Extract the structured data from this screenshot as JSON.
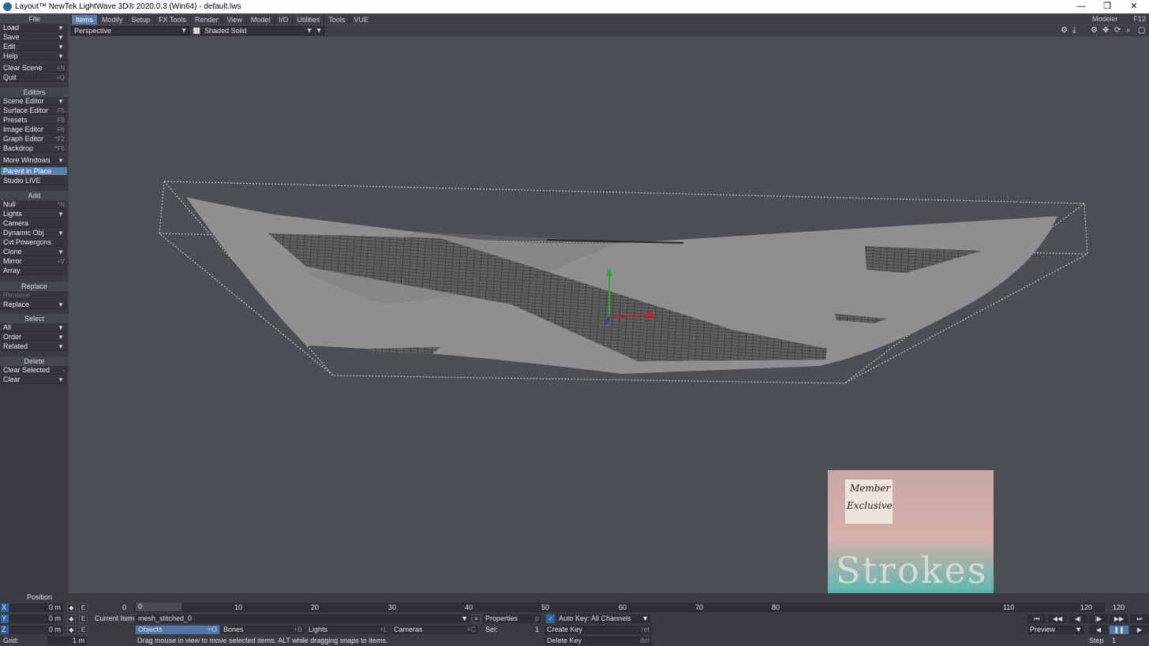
{
  "window": {
    "title": "Layout™ NewTek LightWave 3D® 2020.0.3 (Win64) - default.lws",
    "min": "—",
    "restore": "❐",
    "close": "✕"
  },
  "menubar": {
    "tabs": [
      "Items",
      "Modify",
      "Setup",
      "FX Tools",
      "Render",
      "View",
      "Model",
      "I/O",
      "Utilities",
      "Tools",
      "VUE"
    ],
    "active": "Items",
    "modeler": "Modeler",
    "modeler_key": "F12"
  },
  "viewbar": {
    "view_mode": "Perspective",
    "shading": "Shaded Solid"
  },
  "sidebar": {
    "file_header": "File",
    "file": [
      {
        "label": "Load",
        "arrow": true
      },
      {
        "label": "Save",
        "arrow": true
      },
      {
        "label": "Edit",
        "arrow": true
      },
      {
        "label": "Help",
        "arrow": true
      }
    ],
    "clear_scene": {
      "label": "Clear Scene",
      "key": "+N"
    },
    "quit": {
      "label": "Quit",
      "key": "+Q"
    },
    "editors_header": "Editors",
    "editors": [
      {
        "label": "Scene Editor",
        "key": ""
      },
      {
        "label": "Surface Editor",
        "key": "F5"
      },
      {
        "label": "Presets",
        "key": "F8"
      },
      {
        "label": "Image Editor",
        "key": "F6"
      },
      {
        "label": "Graph Editor",
        "key": "^F2"
      },
      {
        "label": "Backdrop",
        "key": "^F5"
      }
    ],
    "more_windows": "More Windows",
    "parent_in_place": "Parent in Place",
    "studio_live": "Studio LIVE",
    "add_header": "Add",
    "add": [
      {
        "label": "Null",
        "key": "^N"
      },
      {
        "label": "Lights",
        "key": ""
      },
      {
        "label": "Camera",
        "key": ""
      },
      {
        "label": "Dynamic Obj",
        "key": ""
      },
      {
        "label": "Cvt Powergons",
        "key": ""
      },
      {
        "label": "Clone",
        "key": ""
      },
      {
        "label": "Mirror",
        "key": "+V"
      },
      {
        "label": "Array",
        "key": ""
      }
    ],
    "replace_header": "Replace",
    "rename": "Rename",
    "replace": "Replace",
    "select_header": "Select",
    "select": [
      "All",
      "Order",
      "Related"
    ],
    "delete_header": "Delete",
    "clear_selected": {
      "label": "Clear Selected",
      "key": "-"
    },
    "clear": "Clear"
  },
  "promo": {
    "line1": "Member",
    "line2": "Exclusive",
    "art_text": "Strokes"
  },
  "bottom": {
    "position_label": "Position",
    "x_label": "X",
    "y_label": "Y",
    "z_label": "Z",
    "x_val": "0 m",
    "y_val": "0 m",
    "z_val": "0 m",
    "e_label": "E",
    "grid_label": "Grid:",
    "grid_val": "1 m",
    "current_item_label": "Current Item",
    "current_item": "mesh_stitched_0",
    "objects": "Objects",
    "objects_key": "+O",
    "bones": "Bones",
    "bones_key": "+B",
    "lights": "Lights",
    "lights_key": "+L",
    "cameras": "Cameras",
    "cameras_key": "+C",
    "properties": "Properties",
    "properties_key": "p",
    "sel_label": "Sel:",
    "sel_val": "1",
    "auto_key": "Auto Key: All Channels",
    "create_key": "Create Key",
    "create_key_sc": "ret",
    "delete_key": "Delete Key",
    "delete_key_sc": "del",
    "status": "Drag mouse in view to move selected items. ALT while dragging snaps to items.",
    "start_frame": "0",
    "current_frame": "0",
    "end_frame": "120",
    "ticks": [
      "10",
      "20",
      "30",
      "40",
      "50",
      "60",
      "70",
      "80",
      "110",
      "120"
    ],
    "preview": "Preview",
    "step_label": "Step",
    "step_val": "1"
  }
}
